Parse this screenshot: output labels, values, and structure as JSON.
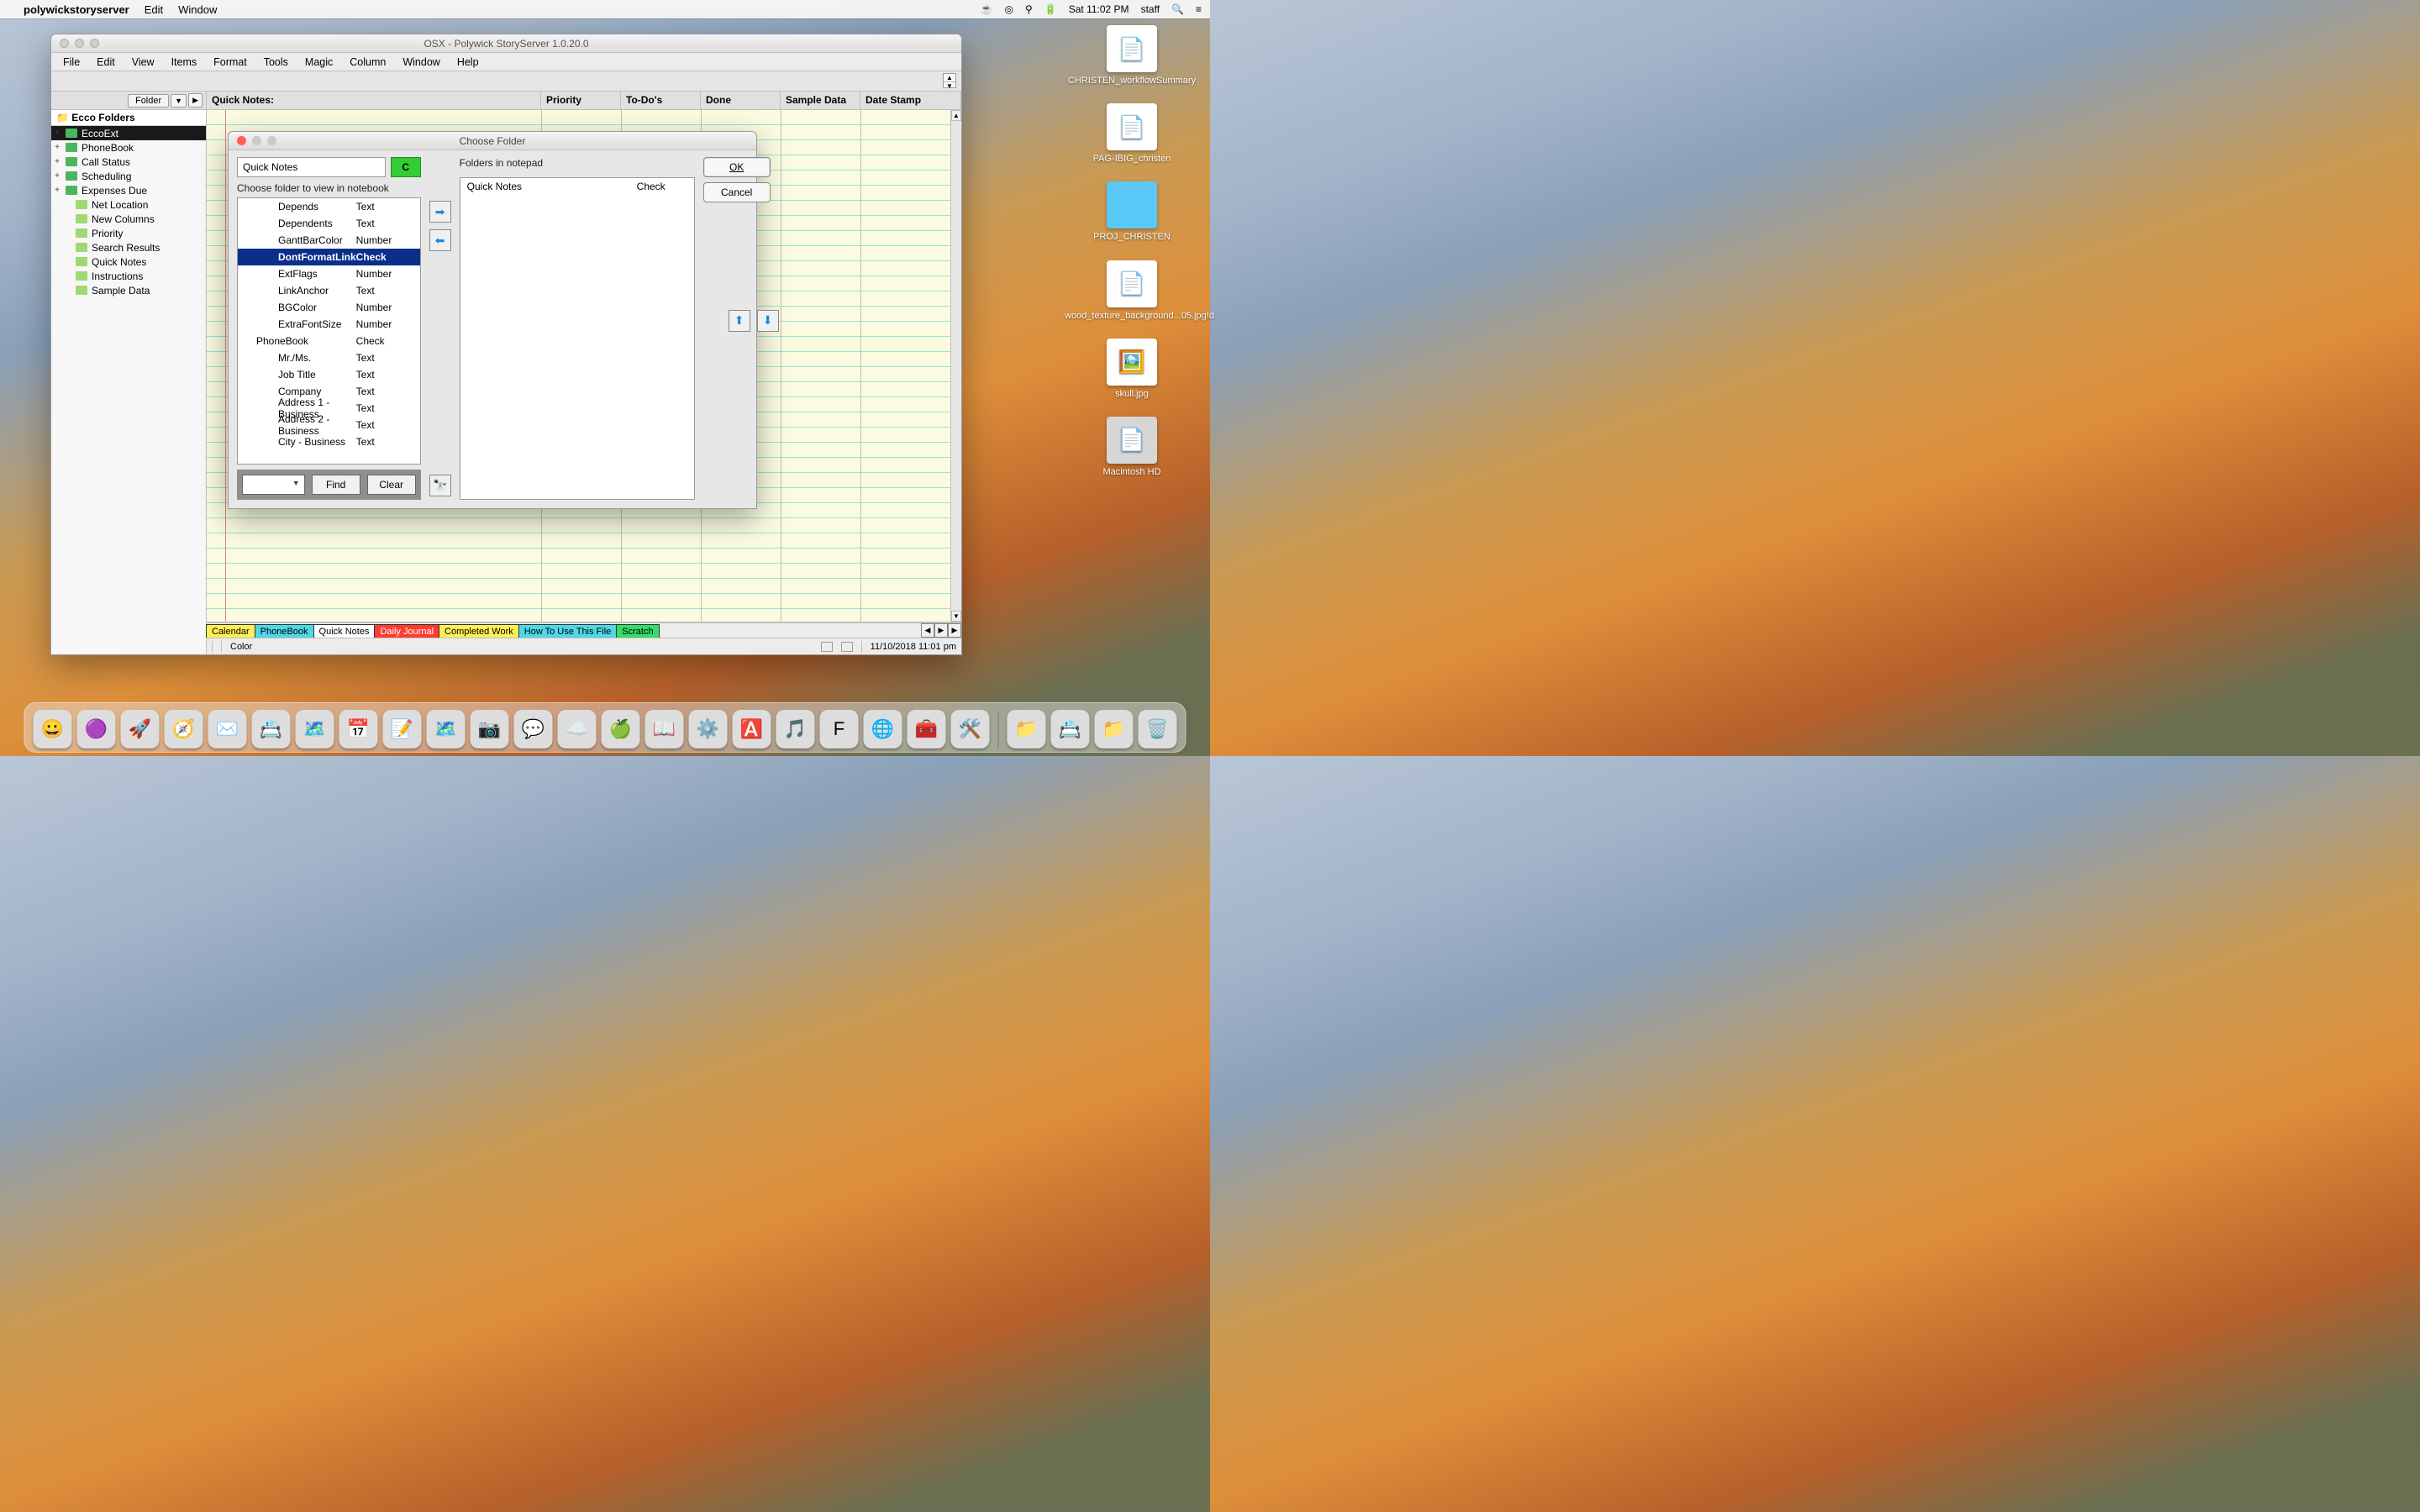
{
  "menubar": {
    "app": "polywickstoryserver",
    "items": [
      "Edit",
      "Window"
    ],
    "right": {
      "time": "Sat 11:02 PM",
      "user": "staff"
    }
  },
  "desktop": [
    {
      "label": "CHRISTEN_workflowSummary",
      "kind": "docx"
    },
    {
      "label": "PAG-IBIG_christen",
      "kind": "doc"
    },
    {
      "label": "PROJ_CHRISTEN",
      "kind": "blue"
    },
    {
      "label": "wood_texture_background...05.jpg!d",
      "kind": "file"
    },
    {
      "label": "skull.jpg",
      "kind": "img"
    },
    {
      "label": "Macintosh HD",
      "kind": "gray"
    }
  ],
  "window": {
    "title": "OSX - Polywick StoryServer 1.0.20.0",
    "menus": [
      "File",
      "Edit",
      "View",
      "Items",
      "Format",
      "Tools",
      "Magic",
      "Column",
      "Window",
      "Help"
    ],
    "side_button": "Folder",
    "tree_root": "Ecco Folders",
    "tree": [
      {
        "label": "EccoExt",
        "exp": "+",
        "sel": true,
        "lvl": 0
      },
      {
        "label": "PhoneBook",
        "exp": "+",
        "lvl": 0
      },
      {
        "label": "Call Status",
        "exp": "+",
        "lvl": 0
      },
      {
        "label": "Scheduling",
        "exp": "+",
        "lvl": 0
      },
      {
        "label": "Expenses Due",
        "exp": "+",
        "lvl": 0
      },
      {
        "label": "Net Location",
        "lvl": 1
      },
      {
        "label": "New Columns",
        "lvl": 1
      },
      {
        "label": "Priority",
        "lvl": 1
      },
      {
        "label": "Search Results",
        "lvl": 1
      },
      {
        "label": "Quick Notes",
        "lvl": 1
      },
      {
        "label": "Instructions",
        "lvl": 1
      },
      {
        "label": "Sample Data",
        "lvl": 1
      }
    ],
    "columns": {
      "main": "Quick Notes:",
      "pri": "Priority",
      "todo": "To-Do's",
      "done": "Done",
      "samp": "Sample Data",
      "date": "Date Stamp"
    },
    "tabs": [
      {
        "label": "Calendar",
        "bg": "#ffee55"
      },
      {
        "label": "PhoneBook",
        "bg": "#4fd7e8"
      },
      {
        "label": "Quick Notes",
        "bg": "#ffffff"
      },
      {
        "label": "Daily Journal",
        "bg": "#ff3b30",
        "fg": "#fff"
      },
      {
        "label": "Completed Work",
        "bg": "#ffee55"
      },
      {
        "label": "How To Use This File",
        "bg": "#4fd7e8"
      },
      {
        "label": "Scratch",
        "bg": "#33dd66"
      }
    ],
    "status_color": "Color",
    "status_time": "11/10/2018 11:01 pm"
  },
  "dialog": {
    "title": "Choose Folder",
    "input_value": "Quick Notes",
    "c_button": "C",
    "left_label": "Choose folder to view in notebook",
    "right_label": "Folders in notepad",
    "ok": "OK",
    "cancel": "Cancel",
    "find": "Find",
    "clear": "Clear",
    "left_rows": [
      {
        "name": "Depends",
        "type": "Text"
      },
      {
        "name": "Dependents",
        "type": "Text"
      },
      {
        "name": "GanttBarColor",
        "type": "Number"
      },
      {
        "name": "DontFormatLink",
        "type": "Check",
        "sel": true
      },
      {
        "name": "ExtFlags",
        "type": "Number"
      },
      {
        "name": "LinkAnchor",
        "type": "Text"
      },
      {
        "name": "BGColor",
        "type": "Number"
      },
      {
        "name": "ExtraFontSize",
        "type": "Number"
      },
      {
        "name": "PhoneBook",
        "type": "Check",
        "hdr": true
      },
      {
        "name": "Mr./Ms.",
        "type": "Text"
      },
      {
        "name": "Job Title",
        "type": "Text"
      },
      {
        "name": "Company",
        "type": "Text"
      },
      {
        "name": "Address 1 - Business",
        "type": "Text"
      },
      {
        "name": "Address 2 - Business",
        "type": "Text"
      },
      {
        "name": "City - Business",
        "type": "Text"
      }
    ],
    "right_rows": [
      {
        "name": "Quick Notes",
        "type": "Check"
      }
    ]
  },
  "dock": [
    "😀",
    "🟣",
    "🚀",
    "🧭",
    "✉️",
    "📇",
    "🗺️",
    "📅",
    "📝",
    "🗺️",
    "📷",
    "💬",
    "☁️",
    "🍏",
    "📖",
    "⚙️",
    "🅰️",
    "🎵",
    "F",
    "🌐",
    "🧰",
    "🛠️",
    "📁",
    "📇",
    "📁",
    "🗑️"
  ]
}
